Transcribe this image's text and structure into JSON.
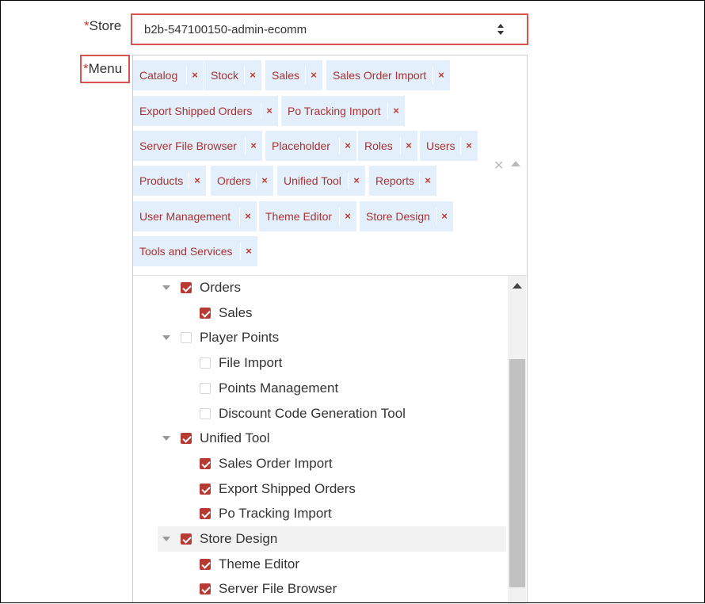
{
  "store": {
    "label_required": "*",
    "label": "Store",
    "value": "b2b-547100150-admin-ecomm"
  },
  "menu": {
    "label_required": "*",
    "label": "Menu",
    "chips": [
      "Catalog",
      "Stock",
      "Sales",
      "Sales Order Import",
      "Export Shipped Orders",
      "Po Tracking Import",
      "Server File Browser",
      "Placeholder",
      "Roles",
      "Users",
      "Products",
      "Orders",
      "Unified Tool",
      "Reports",
      "User Management",
      "Theme Editor",
      "Store Design",
      "Tools and Services"
    ],
    "chip_remove_glyph": "×",
    "clear_all_glyph": "✕",
    "tree": [
      {
        "label": "Orders",
        "checked": true,
        "level": 0
      },
      {
        "label": "Sales",
        "checked": true,
        "level": 1
      },
      {
        "label": "Player Points",
        "checked": false,
        "level": 0
      },
      {
        "label": "File Import",
        "checked": false,
        "level": 1
      },
      {
        "label": "Points Management",
        "checked": false,
        "level": 1
      },
      {
        "label": "Discount Code Generation Tool",
        "checked": false,
        "level": 1
      },
      {
        "label": "Unified Tool",
        "checked": true,
        "level": 0
      },
      {
        "label": "Sales Order Import",
        "checked": true,
        "level": 1
      },
      {
        "label": "Export Shipped Orders",
        "checked": true,
        "level": 1
      },
      {
        "label": "Po Tracking Import",
        "checked": true,
        "level": 1
      },
      {
        "label": "Store Design",
        "checked": true,
        "level": 0,
        "highlighted": true
      },
      {
        "label": "Theme Editor",
        "checked": true,
        "level": 1
      },
      {
        "label": "Server File Browser",
        "checked": true,
        "level": 1
      }
    ]
  },
  "colors": {
    "accent": "#b83a34",
    "chip_bg": "#e3f0fb",
    "required": "#c0392b",
    "error_border": "#d9534f"
  }
}
